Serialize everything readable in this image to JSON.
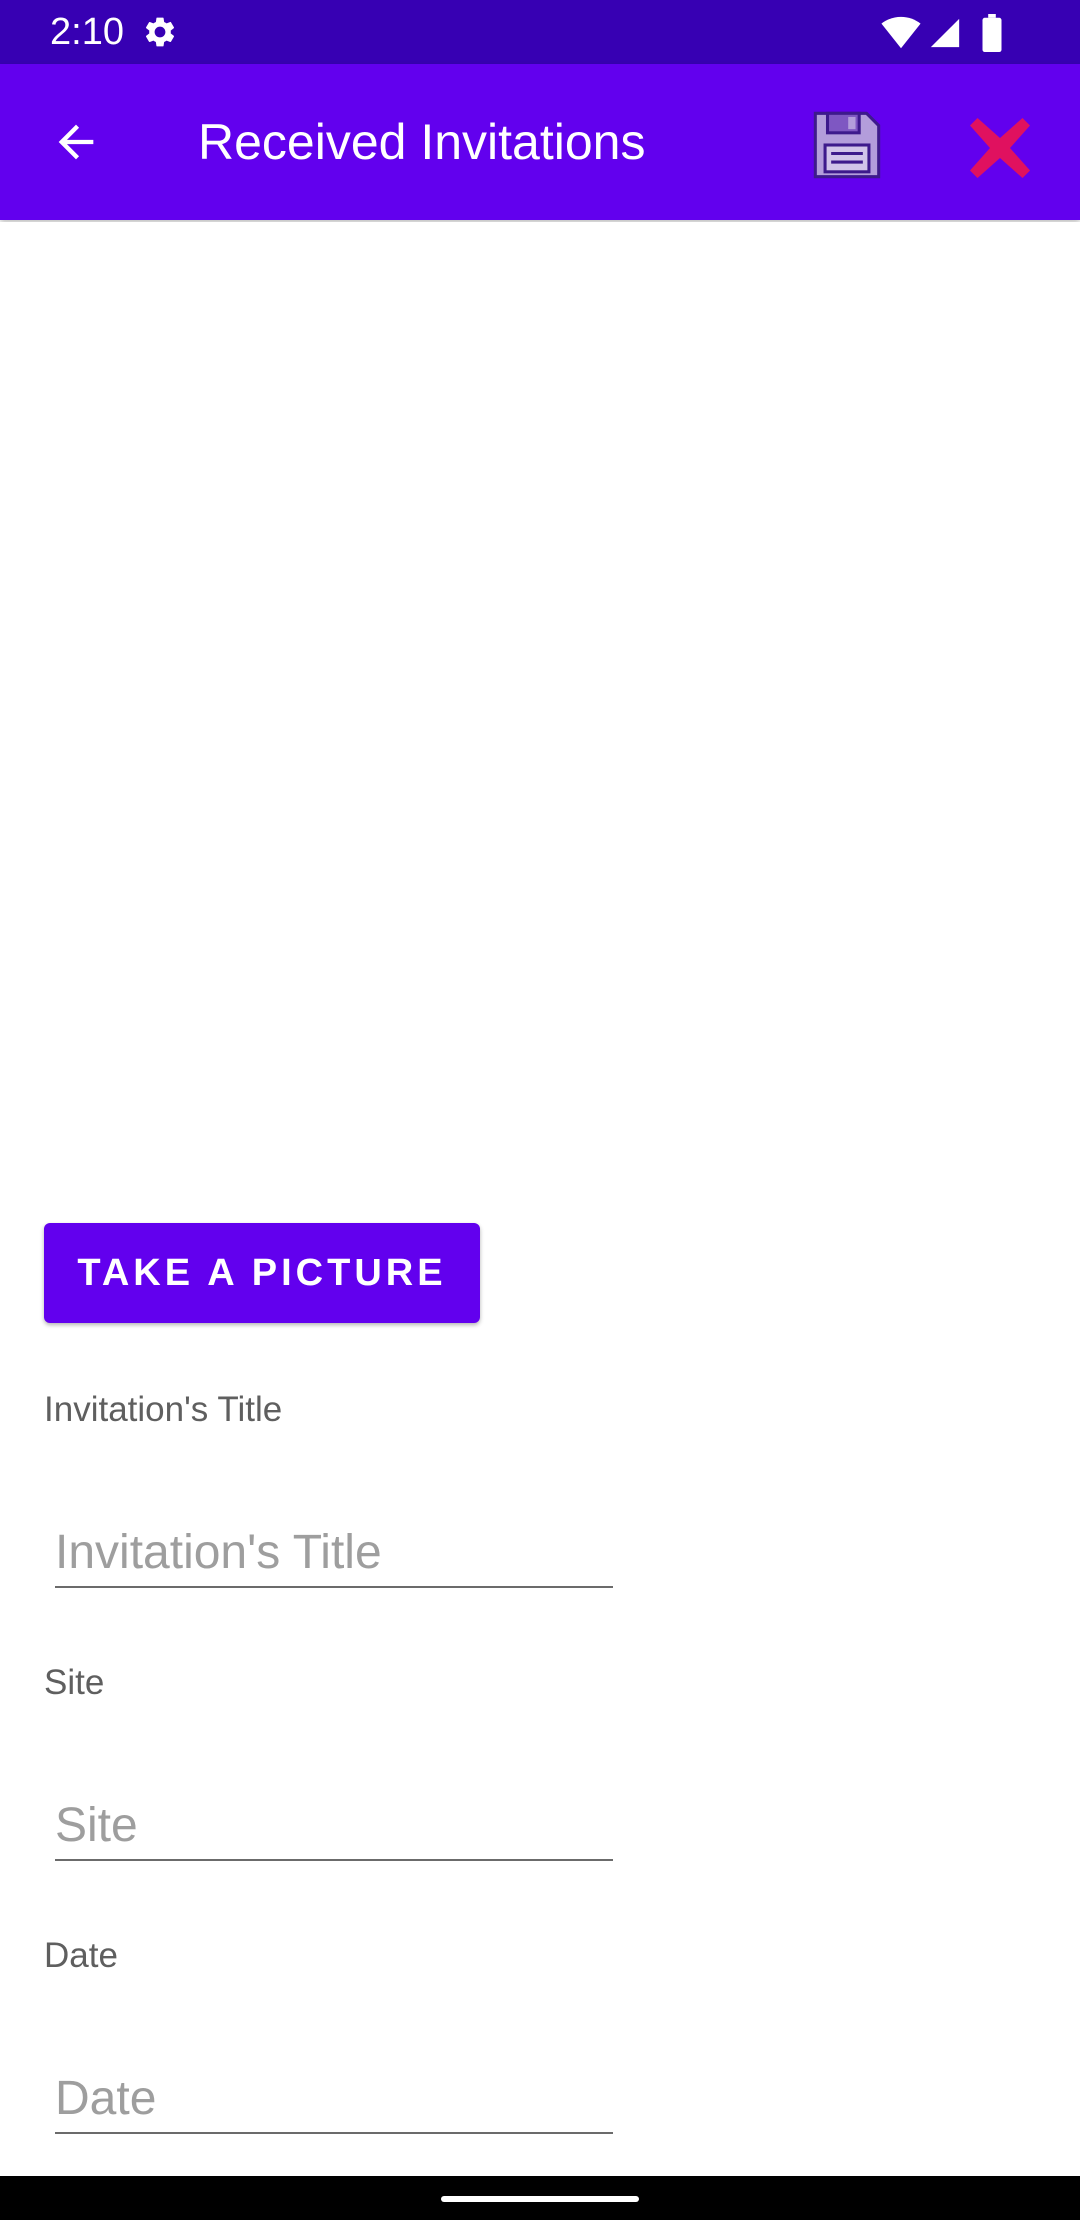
{
  "status_bar": {
    "time": "2:10",
    "icons": [
      "gear-icon",
      "wifi-icon",
      "signal-icon",
      "battery-icon"
    ]
  },
  "app_bar": {
    "title": "Received Invitations",
    "back_icon": "arrow-left-icon",
    "save_icon": "floppy-disk-icon",
    "close_icon": "close-x-icon"
  },
  "form": {
    "take_picture_label": "TAKE A PICTURE",
    "title_label": "Invitation's Title",
    "title_placeholder": "Invitation's Title",
    "site_label": "Site",
    "site_placeholder": "Site",
    "date_label": "Date",
    "date_placeholder": "Date"
  },
  "colors": {
    "status_bar": "#3700b3",
    "app_bar": "#6200ee",
    "accent": "#6200ee",
    "close_icon": "#e0115f",
    "save_icon": "#b39ddb"
  }
}
